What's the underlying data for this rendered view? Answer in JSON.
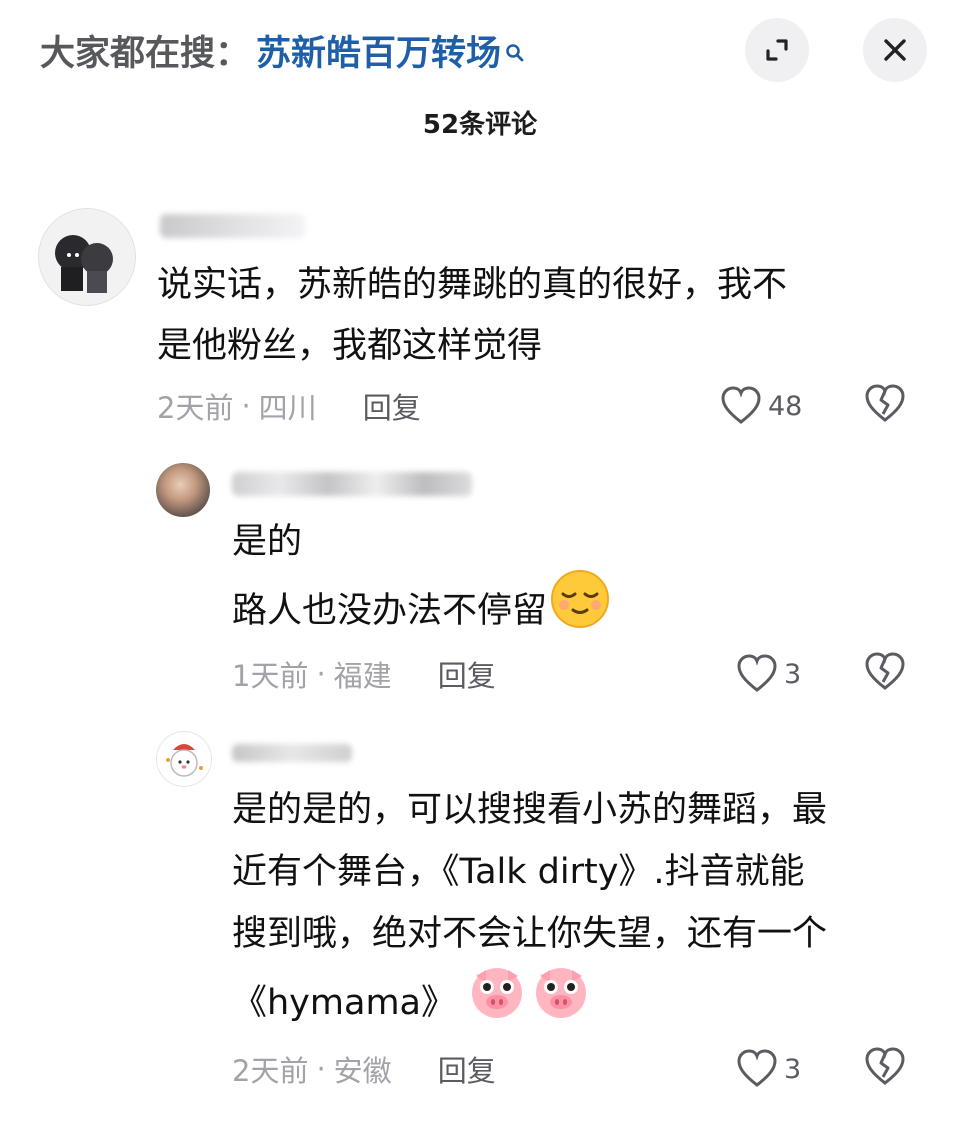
{
  "header": {
    "search_prefix": "大家都在搜：",
    "search_term": "苏新皓百万转场",
    "comment_count": "52条评论"
  },
  "comments": [
    {
      "lines": [
        "说实话，苏新皓的舞跳的真的很好，我不",
        "是他粉丝，我都这样觉得"
      ],
      "time": "2天前",
      "location": "四川",
      "reply_label": "回复",
      "likes": "48"
    },
    {
      "lines": [
        "是的",
        "路人也没办法不停留"
      ],
      "time": "1天前",
      "location": "福建",
      "reply_label": "回复",
      "likes": "3"
    },
    {
      "lines": [
        "是的是的，可以搜搜看小苏的舞蹈，最",
        "近有个舞台，《Talk dirty》.抖音就能",
        "搜到哦，绝对不会让你失望，还有一个",
        "《hymama》"
      ],
      "time": "2天前",
      "location": "安徽",
      "reply_label": "回复",
      "likes": "3"
    }
  ],
  "icons": {
    "search": "search-icon",
    "expand": "expand-icon",
    "close": "close-icon",
    "like": "heart-icon",
    "dislike": "broken-heart-icon",
    "emoji_smile": "relieved-face-emoji",
    "emoji_pig": "pig-face-emoji"
  },
  "colors": {
    "search_term": "#1f5fa8",
    "muted_text": "#a2a3a8",
    "button_bg": "#f0f0f2"
  }
}
